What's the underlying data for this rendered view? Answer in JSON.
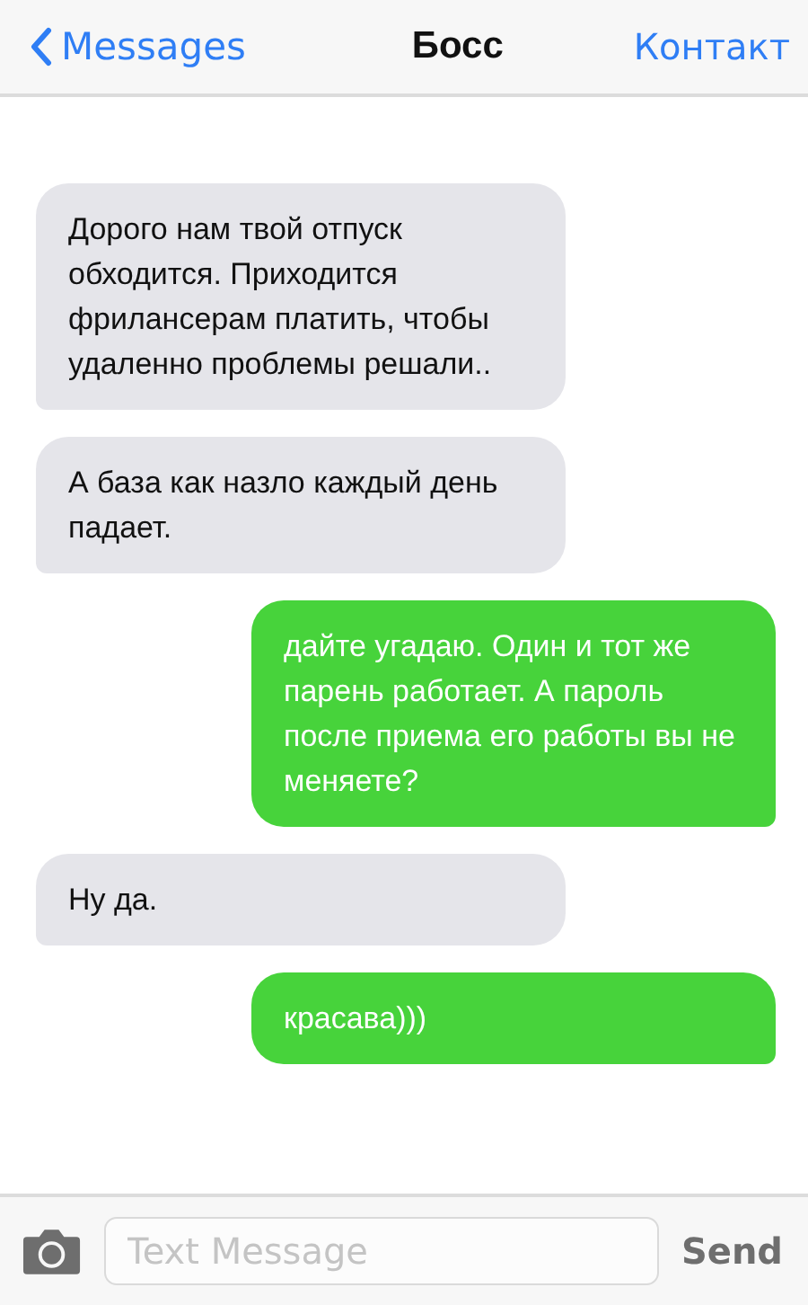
{
  "nav": {
    "back": "Messages",
    "title": "Босс",
    "action": "Контакт"
  },
  "messages": [
    {
      "kind": "incoming",
      "text": "Дорого нам твой отпуск обходится. Приходится фрилансерам платить, чтобы удаленно проблемы решали.."
    },
    {
      "kind": "incoming",
      "text": "А база как назло каждый день падает."
    },
    {
      "kind": "outgoing",
      "text": "дайте угадаю. Один и тот же парень работает. А пароль после приема его работы вы не меняете?"
    },
    {
      "kind": "incoming",
      "text": "Ну да."
    },
    {
      "kind": "outgoing",
      "text": "красава)))"
    }
  ],
  "composer": {
    "placeholder": "Text Message",
    "send": "Send"
  }
}
